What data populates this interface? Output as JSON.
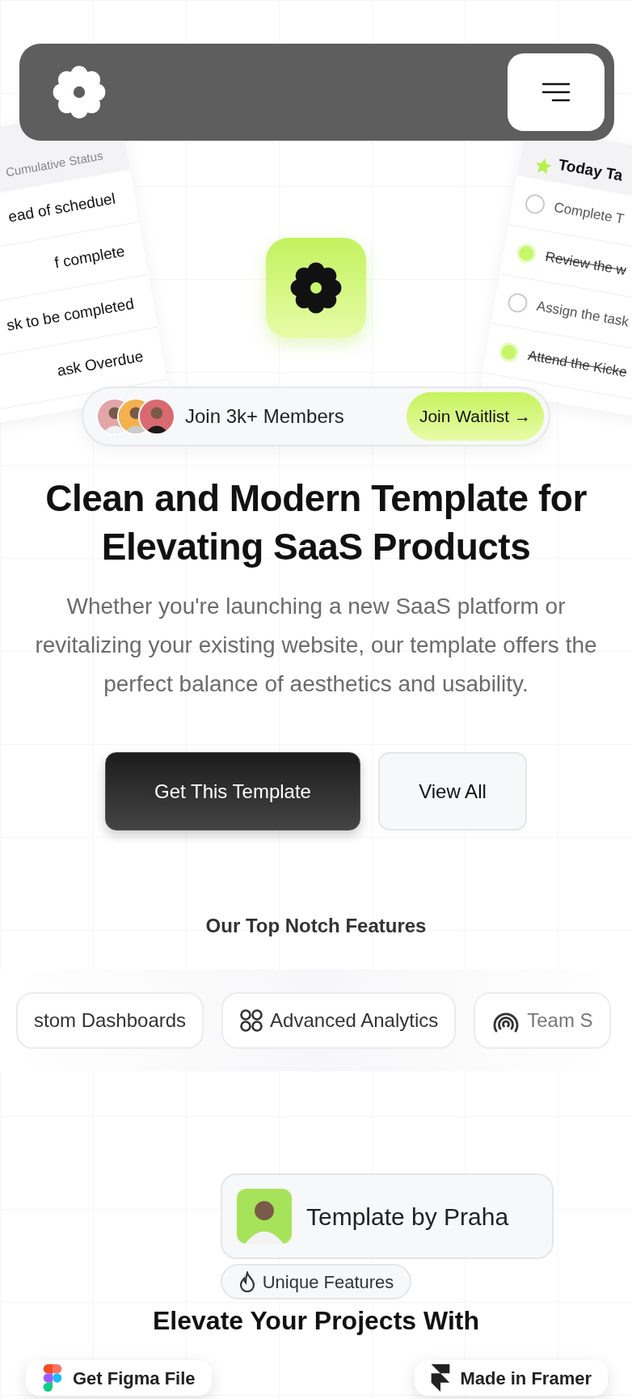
{
  "left_card": {
    "title": "Cumulative Status",
    "rows": [
      "ead of scheduel",
      "f complete",
      "sk to be completed",
      "ask Overdue"
    ]
  },
  "right_card": {
    "title": "Today Ta",
    "tasks": [
      {
        "label": "Complete T",
        "checked": false
      },
      {
        "label": "Review the w",
        "checked": true
      },
      {
        "label": "Assign the task",
        "checked": false
      },
      {
        "label": "Attend the Kicke",
        "checked": true
      }
    ]
  },
  "members": {
    "text": "Join 3k+ Members",
    "button": "Join Waitlist →"
  },
  "hero": {
    "title": "Clean and Modern Template for Elevating SaaS Products",
    "subtitle": "Whether you're launching a new SaaS platform or revitalizing your existing website, our template offers the perfect balance of aesthetics and usability."
  },
  "buttons": [
    {
      "label": "Get This Template",
      "kind": "primary"
    },
    {
      "label": "View All",
      "kind": "secondary"
    }
  ],
  "features": {
    "title": "Our Top Notch Features",
    "chips": [
      {
        "label": "stom Dashboards",
        "kind": "plain"
      },
      {
        "label": "Advanced Analytics",
        "kind": "analytics"
      },
      {
        "label": "Team S",
        "kind": "team"
      }
    ]
  },
  "author": {
    "text": "Template by Praha"
  },
  "section": {
    "badge": "Unique Features",
    "heading": "Elevate Your Projects With"
  },
  "floating": [
    {
      "label": "Get Figma File",
      "kind": "figma"
    },
    {
      "label": "Made in Framer",
      "kind": "framer"
    }
  ]
}
